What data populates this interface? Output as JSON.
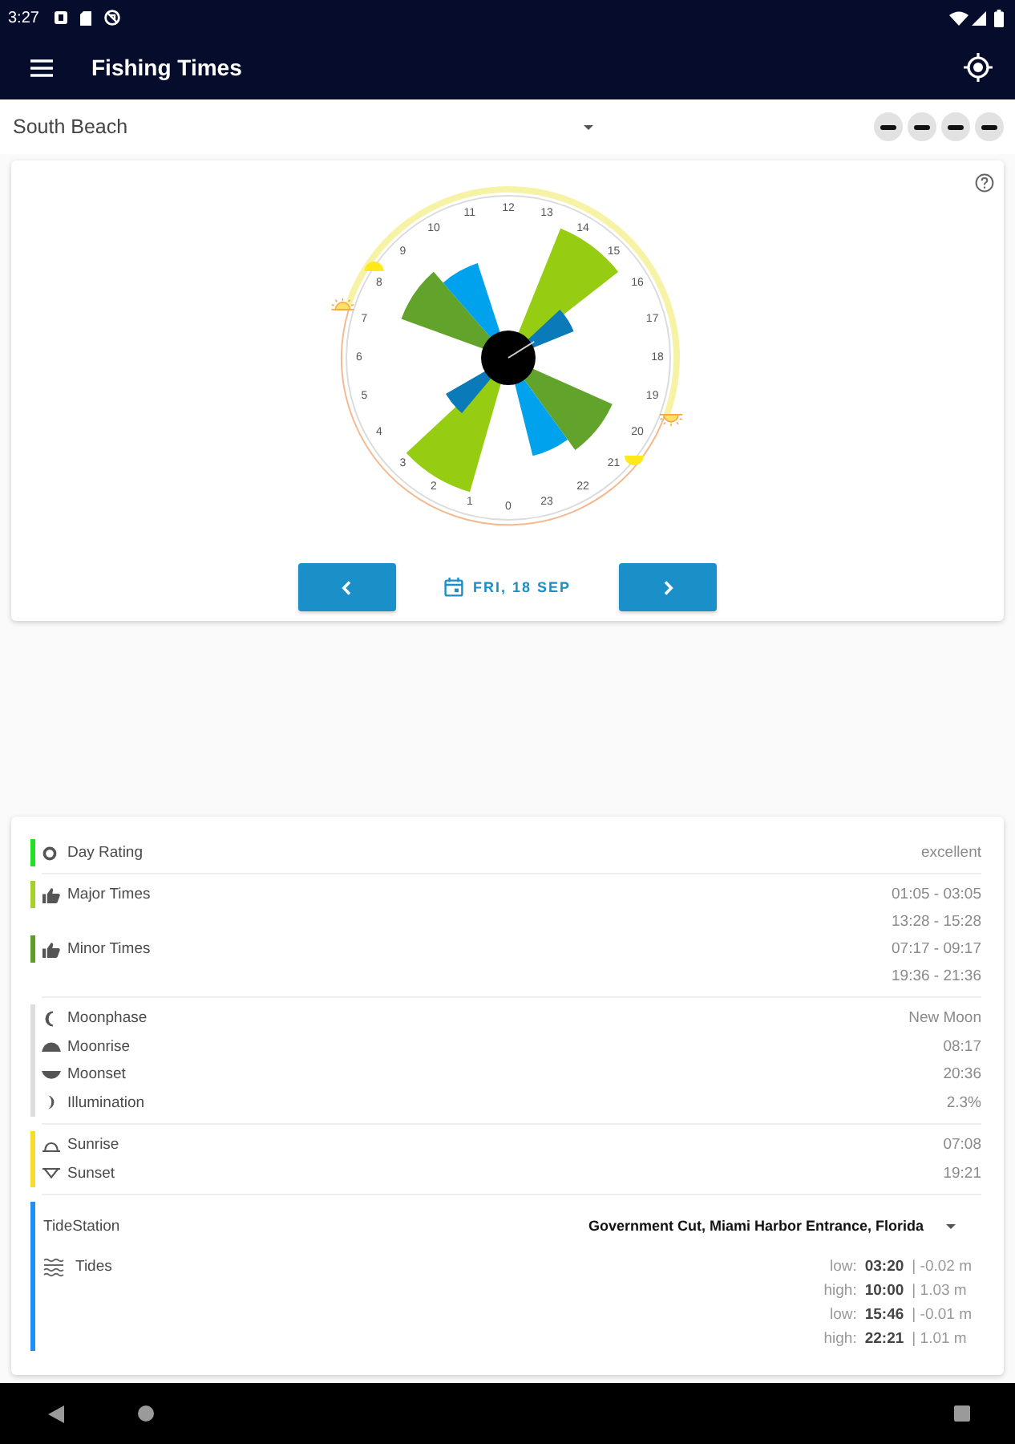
{
  "status_bar": {
    "time": "3:27"
  },
  "app_bar": {
    "title": "Fishing Times"
  },
  "location": {
    "value": "South Beach"
  },
  "dial": {
    "hour_labels": [
      "12",
      "13",
      "14",
      "15",
      "16",
      "17",
      "18",
      "19",
      "20",
      "21",
      "22",
      "23",
      "0",
      "1",
      "2",
      "3",
      "4",
      "5",
      "6",
      "7",
      "8",
      "9",
      "10",
      "11"
    ]
  },
  "date_nav": {
    "date": "FRI, 18 SEP"
  },
  "details": [
    {
      "kind": "rating",
      "label": "Day Rating",
      "color": "#22e022",
      "values": [
        "excellent"
      ]
    },
    {
      "kind": "times",
      "label": "Major Times",
      "color": "#a6d12a",
      "values": [
        "01:05 - 03:05",
        "13:28 - 15:28"
      ]
    },
    {
      "kind": "times",
      "label": "Minor Times",
      "color": "#5f9d2b",
      "values": [
        "07:17 - 09:17",
        "19:36 - 21:36"
      ]
    },
    {
      "kind": "moon",
      "color": "#dddddd",
      "rows": [
        {
          "kind": "phase",
          "label": "Moonphase",
          "value": "New Moon"
        },
        {
          "kind": "rise",
          "label": "Moonrise",
          "value": "08:17"
        },
        {
          "kind": "set",
          "label": "Moonset",
          "value": "20:36"
        },
        {
          "kind": "illumination",
          "label": "Illumination",
          "value": "2.3%"
        }
      ]
    },
    {
      "kind": "sun",
      "color": "#f5dc2e",
      "rows": [
        {
          "kind": "rise",
          "label": "Sunrise",
          "value": "07:08"
        },
        {
          "kind": "set",
          "label": "Sunset",
          "value": "19:21"
        }
      ]
    },
    {
      "kind": "tide",
      "color": "#1e8ff5",
      "station_label": "TideStation",
      "station": "Government Cut, Miami Harbor Entrance, Florida",
      "label": "Tides",
      "entries": [
        {
          "type": "low:",
          "time": "03:20",
          "height": "| -0.02 m"
        },
        {
          "type": "high:",
          "time": "10:00",
          "height": "| 1.03 m"
        },
        {
          "type": "low:",
          "time": "15:46",
          "height": "| -0.01 m"
        },
        {
          "type": "high:",
          "time": "22:21",
          "height": "| 1.01 m"
        }
      ]
    }
  ]
}
